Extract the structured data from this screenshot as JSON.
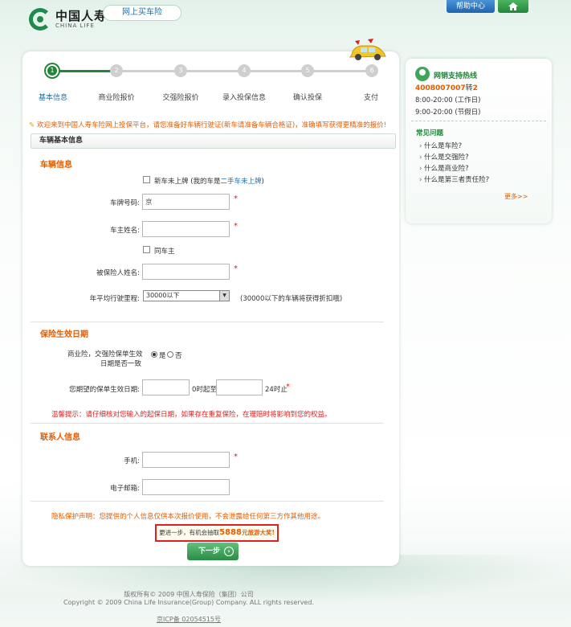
{
  "header": {
    "logo_cn": "中国人寿",
    "logo_en": "CHINA LIFE",
    "slogan": "网上买车险",
    "help_label": "帮助中心",
    "home_icon": "home-icon"
  },
  "steps": [
    {
      "num": "1",
      "label": "基本信息",
      "active": true
    },
    {
      "num": "2",
      "label": "商业险报价",
      "active": false
    },
    {
      "num": "3",
      "label": "交强险报价",
      "active": false
    },
    {
      "num": "4",
      "label": "录入投保信息",
      "active": false
    },
    {
      "num": "5",
      "label": "确认投保",
      "active": false
    },
    {
      "num": "6",
      "label": "支付",
      "active": false
    }
  ],
  "notice": "欢迎来到中国人寿车险网上投保平台，请您准备好车辆行驶证(新车请准备车辆合格证)，准确填写获得更精准的报价!",
  "section_title": "车辆基本信息",
  "vehicle": {
    "title": "车辆信息",
    "new_car_label": "新车未上牌 (我的车是",
    "second_hand_link": "二手车未上牌",
    "new_car_close": ")",
    "plate_label": "车牌号码:",
    "plate_value": "京",
    "owner_label": "车主姓名:",
    "owner_value": "",
    "same_owner_label": "同车主",
    "insured_label": "被保险人姓名:",
    "insured_value": "",
    "mileage_label": "年平均行驶里程:",
    "mileage_selected": "30000以下",
    "mileage_note": "(30000以下的车辆将获得折扣哦)"
  },
  "effective": {
    "title": "保险生效日期",
    "same_date_label_1": "商业险，交强险保单生效",
    "same_date_label_2": "日期是否一致",
    "yes": "是",
    "no": "否",
    "date_label": "您期望的保单生效日期:",
    "time_start": "0时起至",
    "time_end": "24时止",
    "tip": "温馨提示：请仔细核对您输入的起保日期，如果存在重复保险，在理赔时将影响到您的权益。"
  },
  "contact": {
    "title": "联系人信息",
    "phone_label": "手机:",
    "email_label": "电子邮箱:"
  },
  "privacy": "隐私保护声明：您提供的个人信息仅供本次报价使用，不会泄露给任何第三方作其他用途。",
  "promo": {
    "prefix": "更进一步，有机会抽取",
    "amount": "5888",
    "suffix": "元旅游大奖!"
  },
  "next_label": "下一步",
  "sidebar": {
    "title": "网销支持热线",
    "phone": "4008007007",
    "ext_prefix": "转",
    "ext": "2",
    "hours_workday": "8:00-20:00 (工作日)",
    "hours_holiday": "9:00-20:00 (节假日)",
    "faq_title": "常见问题",
    "faqs": [
      "什么是车险?",
      "什么是交强险?",
      "什么是商业险?",
      "什么是第三者责任险?"
    ],
    "more": "更多>>"
  },
  "footer": {
    "cn": "版权所有© 2009 中国人寿保险（集团）公司",
    "en": "Copyright © 2009 China Life Insurance(Group) Company. ALL rights reserved.",
    "icp": "京ICP备 02054515号"
  },
  "colors": {
    "brand_green": "#23843a",
    "accent_orange": "#e45c00",
    "link_blue": "#1f6fa8",
    "required_red": "#e02020"
  }
}
